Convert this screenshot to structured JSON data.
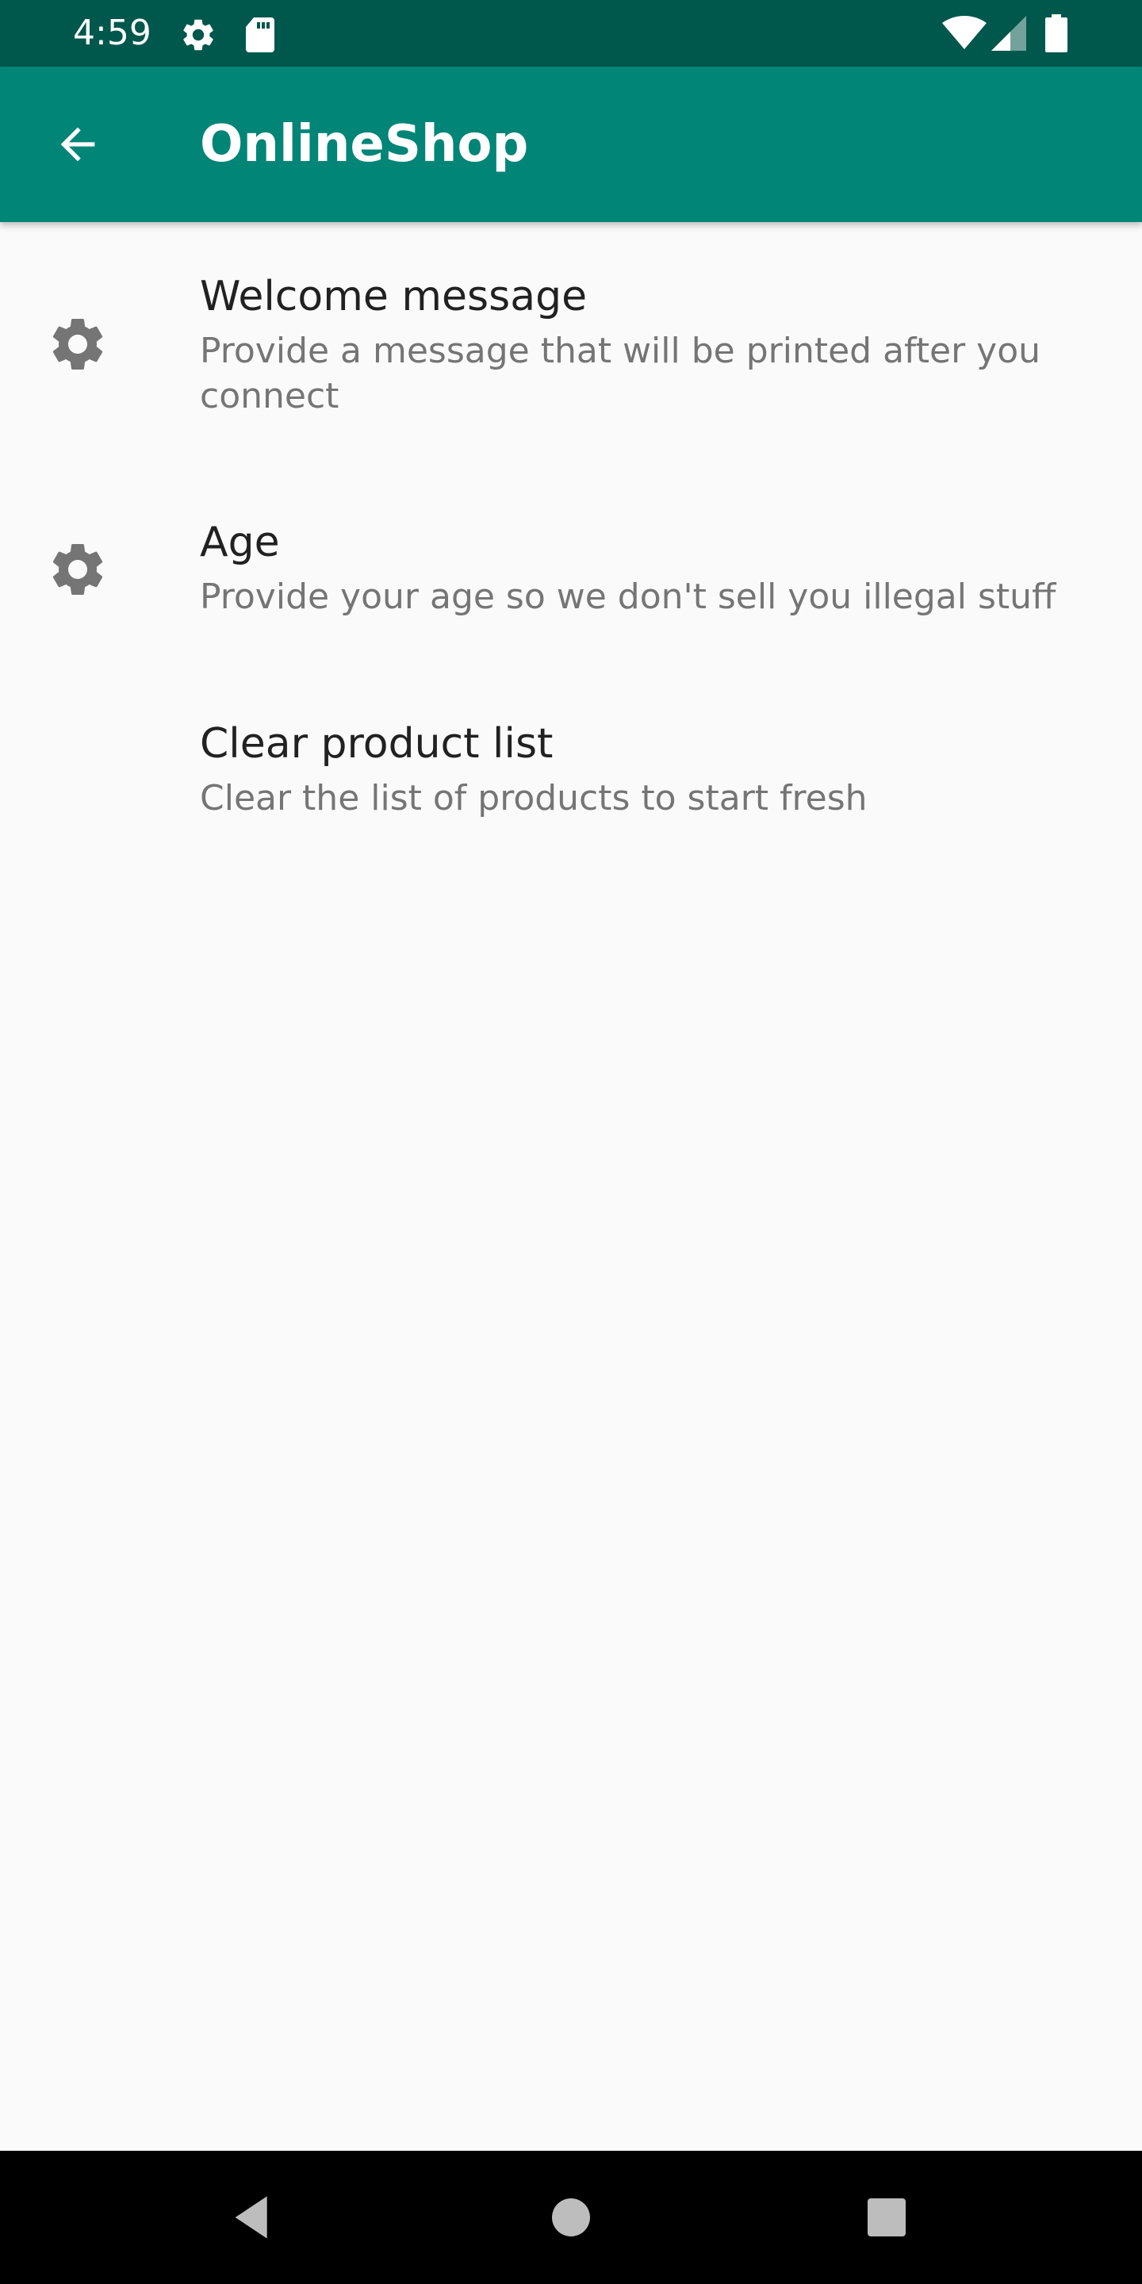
{
  "status_bar": {
    "time": "4:59",
    "icons": [
      "gear-icon",
      "sd-card-icon",
      "wifi-icon",
      "signal-icon",
      "battery-icon"
    ],
    "background_color": "#00574b"
  },
  "app_bar": {
    "title": "OnlineShop",
    "back_icon": "arrow-left-icon",
    "background_color": "#008577"
  },
  "preferences": [
    {
      "title": "Welcome message",
      "summary": "Provide a message that will be printed after you connect",
      "icon": "gear-icon"
    },
    {
      "title": "Age",
      "summary": "Provide your age so we don't sell you illegal stuff",
      "icon": "gear-icon"
    },
    {
      "title": "Clear product list",
      "summary": "Clear the list of products to start fresh",
      "icon": ""
    }
  ],
  "nav_bar": {
    "buttons": [
      "back-triangle-icon",
      "home-circle-icon",
      "recents-square-icon"
    ]
  }
}
